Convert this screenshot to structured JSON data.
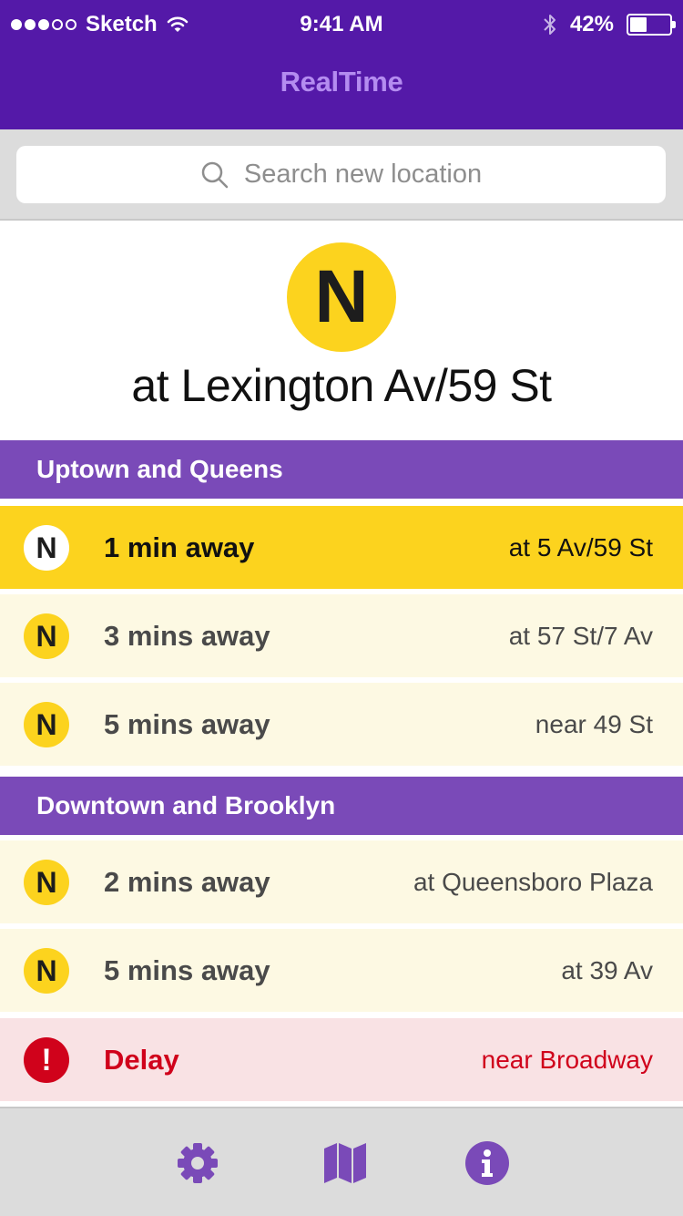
{
  "status_bar": {
    "carrier": "Sketch",
    "time": "9:41 AM",
    "battery_percent": "42%",
    "battery_level": 0.42,
    "signal_bars_filled": 3,
    "signal_bars_total": 5
  },
  "nav": {
    "title": "RealTime"
  },
  "search": {
    "placeholder": "Search new location"
  },
  "station": {
    "line": "N",
    "name": "at Lexington Av/59 St"
  },
  "sections": [
    {
      "title": "Uptown and Queens",
      "rows": [
        {
          "line": "N",
          "eta": "1 min away",
          "location": "at 5 Av/59 St",
          "state": "highlight"
        },
        {
          "line": "N",
          "eta": "3 mins away",
          "location": "at 57 St/7 Av",
          "state": "normal"
        },
        {
          "line": "N",
          "eta": "5 mins away",
          "location": "near 49 St",
          "state": "normal"
        }
      ]
    },
    {
      "title": "Downtown and Brooklyn",
      "rows": [
        {
          "line": "N",
          "eta": "2 mins away",
          "location": "at Queensboro Plaza",
          "state": "normal"
        },
        {
          "line": "N",
          "eta": "5 mins away",
          "location": "at 39 Av",
          "state": "normal"
        },
        {
          "line": "!",
          "eta": "Delay",
          "location": "near Broadway",
          "state": "delay"
        }
      ]
    }
  ],
  "tab_bar": {
    "icons": [
      "gear-icon",
      "map-icon",
      "info-icon"
    ]
  },
  "colors": {
    "header_bg": "#5419a8",
    "title": "#b48cf0",
    "section_bg": "#7a4ab8",
    "line_n_yellow": "#fcd31e",
    "row_bg": "#fdf9e3",
    "delay_red": "#d0021b",
    "delay_bg": "#f9e2e4",
    "tab_icon": "#7a4ab8"
  }
}
